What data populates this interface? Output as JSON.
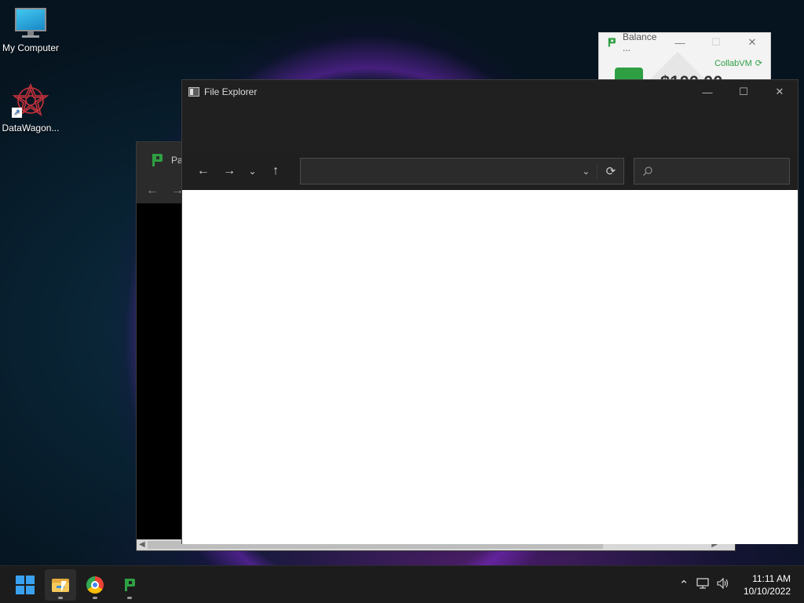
{
  "desktop": {
    "icons": [
      {
        "label": "My Computer",
        "icon": "monitor-icon"
      },
      {
        "label": "DataWagon...",
        "icon": "datawagon-icon"
      }
    ]
  },
  "balance_window": {
    "title": "Balance ...",
    "brand": "CollabVM",
    "amount": "$100.00"
  },
  "background_window": {
    "title": "Pa"
  },
  "file_explorer": {
    "title": "File Explorer",
    "address": "",
    "search_placeholder": ""
  },
  "taskbar": {
    "time": "11:11 AM",
    "date": "10/10/2022",
    "apps": [
      "start",
      "file-explorer",
      "chrome",
      "collabvm-app"
    ]
  },
  "colors": {
    "accent": "#3aa0f0",
    "app_green": "#2ea043",
    "explorer_bg": "#202020"
  }
}
